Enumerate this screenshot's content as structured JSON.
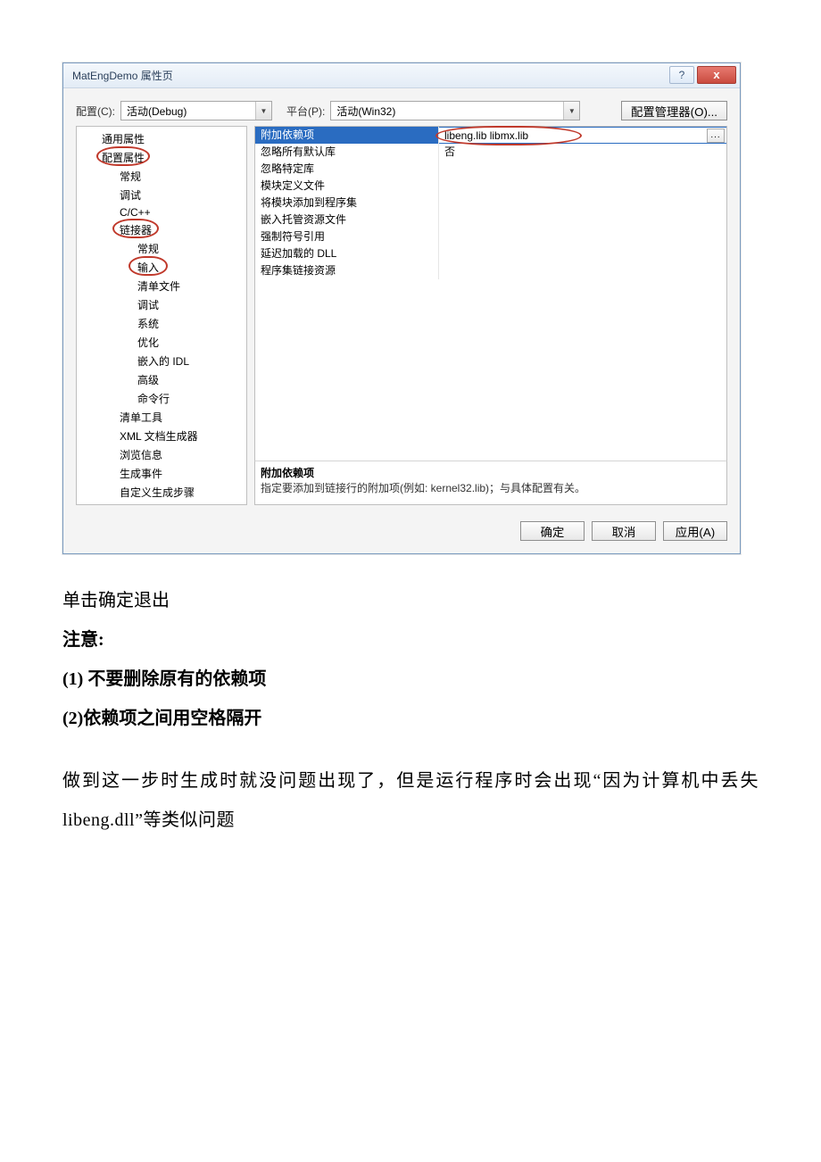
{
  "dialog": {
    "title": "MatEngDemo 属性页",
    "help_btn": "?",
    "close_btn": "x",
    "config_label": "配置(C):",
    "config_value": "活动(Debug)",
    "platform_label": "平台(P):",
    "platform_value": "活动(Win32)",
    "config_mgr_btn": "配置管理器(O)...",
    "tree": {
      "t1": "通用属性",
      "t2": "配置属性",
      "t3": "常规",
      "t4": "调试",
      "t5": "C/C++",
      "t6": "链接器",
      "t7": "常规",
      "t8": "输入",
      "t9": "清单文件",
      "t10": "调试",
      "t11": "系统",
      "t12": "优化",
      "t13": "嵌入的 IDL",
      "t14": "高级",
      "t15": "命令行",
      "t16": "清单工具",
      "t17": "XML 文档生成器",
      "t18": "浏览信息",
      "t19": "生成事件",
      "t20": "自定义生成步骤"
    },
    "props": {
      "r1_label": "附加依赖项",
      "r1_value": "libeng.lib libmx.lib",
      "r2_label": "忽略所有默认库",
      "r2_value": "否",
      "r3_label": "忽略特定库",
      "r4_label": "模块定义文件",
      "r5_label": "将模块添加到程序集",
      "r6_label": "嵌入托管资源文件",
      "r7_label": "强制符号引用",
      "r8_label": "延迟加载的 DLL",
      "r9_label": "程序集链接资源"
    },
    "desc_title": "附加依赖项",
    "desc_text": "指定要添加到链接行的附加项(例如: kernel32.lib)；与具体配置有关。",
    "ok_btn": "确定",
    "cancel_btn": "取消",
    "apply_btn": "应用(A)"
  },
  "doc": {
    "line1": "单击确定退出",
    "line2": "注意:",
    "line3": "(1) 不要删除原有的依赖项",
    "line4": "(2)依赖项之间用空格隔开",
    "para1": "做到这一步时生成时就没问题出现了，但是运行程序时会出现“因为计算机中丢失 libeng.dll”等类似问题"
  }
}
